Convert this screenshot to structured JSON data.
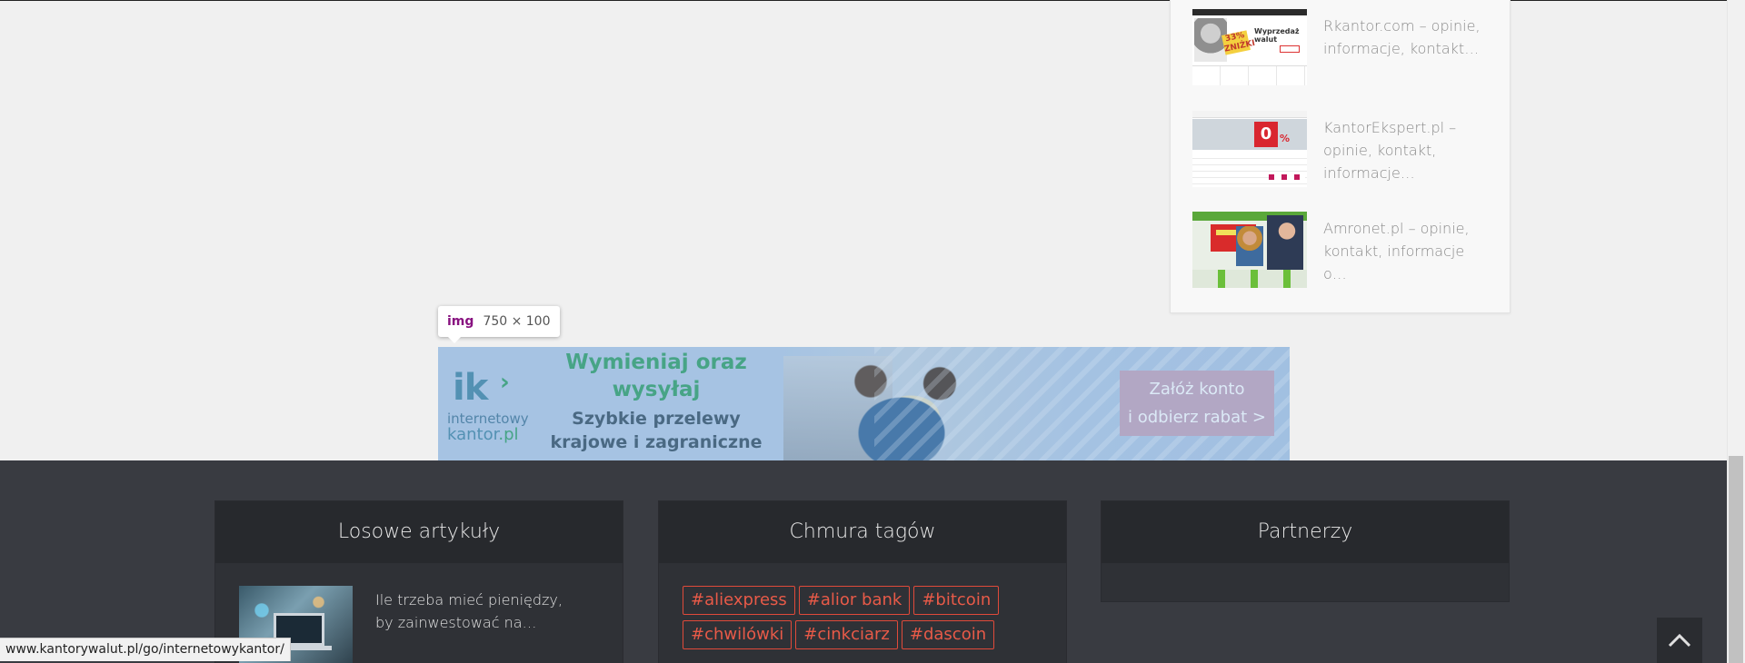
{
  "sidebar": {
    "items": [
      {
        "title": "Rkantor.com – opinie, informacje, kontakt…",
        "thumb_badge": "33% ZNIŻKI",
        "thumb_heading": "Wyprzedaż walut"
      },
      {
        "title": "KantorEkspert.pl – opinie, kontakt, informacje…",
        "thumb_badge": "0",
        "thumb_pct": "%"
      },
      {
        "title": "Amronet.pl – opinie, kontakt, informacje o…"
      }
    ]
  },
  "devtools_tooltip": {
    "tag": "img",
    "dimensions": "750 × 100"
  },
  "banner": {
    "logo_ik": "ik",
    "logo_chevron": "›",
    "logo_line1": "internetowy",
    "logo_line2_a": "kantor",
    "logo_line2_b": ".pl",
    "headline": "Wymieniaj oraz wysyłaj",
    "subheadline": "Szybkie przelewy krajowe i zagraniczne",
    "cta_line1": "Załóż konto",
    "cta_line2": "i odbierz rabat  >"
  },
  "footer": {
    "widgets": [
      {
        "title": "Losowe artykuły",
        "article_title": "Ile trzeba mieć pieniędzy, by zainwestować na…"
      },
      {
        "title": "Chmura tagów",
        "tags": [
          "#aliexpress",
          "#alior bank",
          "#bitcoin",
          "#chwilówki",
          "#cinkciarz",
          "#dascoin"
        ]
      },
      {
        "title": "Partnerzy"
      }
    ]
  },
  "status_url": "www.kantorywalut.pl/go/internetowykantor/",
  "colors": {
    "footer_bg": "#393b41",
    "tag_accent": "#e04a3a",
    "banner_green": "#3aa36a"
  },
  "icons": {
    "back_to_top": "chevron-up-icon"
  }
}
